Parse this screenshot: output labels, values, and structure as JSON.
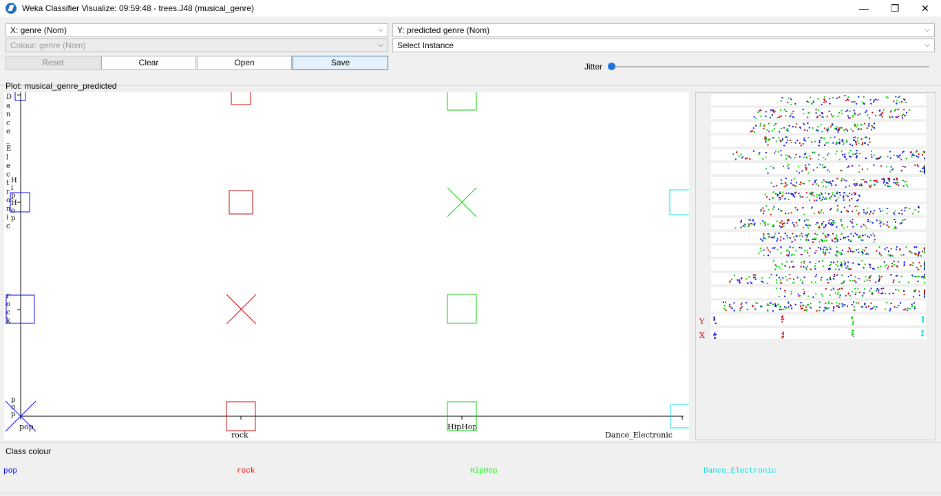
{
  "window": {
    "title": "Weka Classifier Visualize: 09:59:48 - trees.J48 (musical_genre)",
    "minimize": "—",
    "maximize": "❐",
    "close": "✕"
  },
  "controls": {
    "x_axis": "X: genre (Nom)",
    "y_axis": "Y: predicted genre (Nom)",
    "colour": "Colour: genre (Nom)",
    "select_instance": "Select Instance",
    "reset_label": "Reset",
    "clear_label": "Clear",
    "open_label": "Open",
    "save_label": "Save",
    "jitter_label": "Jitter",
    "jitter_value": 0
  },
  "plot": {
    "label": "Plot: musical_genre_predicted",
    "x_categories": [
      "pop",
      "rock",
      "HipHop",
      "Dance_Electronic"
    ],
    "y_categories": [
      "pop",
      "rock",
      "HipHop",
      "Dance_Electronic"
    ],
    "x_tick_labels": [
      "pop",
      "rock",
      "HipHop",
      "Dance_Electronic"
    ],
    "y_tick_labels": [
      "pop",
      "rock",
      "HipHop",
      "Dance_Electronic"
    ]
  },
  "matrix": {
    "y_label": "Y",
    "x_label": "X"
  },
  "legend": {
    "title": "Class colour",
    "items": [
      {
        "label": "pop",
        "color": "#0000ff"
      },
      {
        "label": "rock",
        "color": "#ff0000"
      },
      {
        "label": "HipHop",
        "color": "#00ff00"
      },
      {
        "label": "Dance_Electronic",
        "color": "#00ffff"
      }
    ]
  },
  "chart_data": {
    "type": "scatter",
    "title": "Plot: musical_genre_predicted",
    "xlabel": "genre",
    "ylabel": "predicted genre",
    "x_categories": [
      "pop",
      "rock",
      "HipHop",
      "Dance_Electronic"
    ],
    "y_categories": [
      "pop",
      "rock",
      "HipHop",
      "Dance_Electronic"
    ],
    "series": [
      {
        "name": "pop",
        "color": "#0000ff",
        "points": [
          {
            "x": "pop",
            "y": "pop",
            "correct": true
          },
          {
            "x": "pop",
            "y": "rock",
            "correct": false
          },
          {
            "x": "pop",
            "y": "HipHop",
            "correct": false
          },
          {
            "x": "pop",
            "y": "Dance_Electronic",
            "correct": false
          }
        ]
      },
      {
        "name": "rock",
        "color": "#cc0000",
        "points": [
          {
            "x": "rock",
            "y": "pop",
            "correct": false
          },
          {
            "x": "rock",
            "y": "rock",
            "correct": true
          },
          {
            "x": "rock",
            "y": "HipHop",
            "correct": false
          },
          {
            "x": "rock",
            "y": "Dance_Electronic",
            "correct": false
          }
        ]
      },
      {
        "name": "HipHop",
        "color": "#00cc00",
        "points": [
          {
            "x": "HipHop",
            "y": "pop",
            "correct": false
          },
          {
            "x": "HipHop",
            "y": "rock",
            "correct": false
          },
          {
            "x": "HipHop",
            "y": "HipHop",
            "correct": true
          },
          {
            "x": "HipHop",
            "y": "Dance_Electronic",
            "correct": false
          }
        ]
      },
      {
        "name": "Dance_Electronic",
        "color": "#00e0e0",
        "points": [
          {
            "x": "Dance_Electronic",
            "y": "pop",
            "correct": false
          },
          {
            "x": "Dance_Electronic",
            "y": "HipHop",
            "correct": false
          }
        ]
      }
    ]
  }
}
